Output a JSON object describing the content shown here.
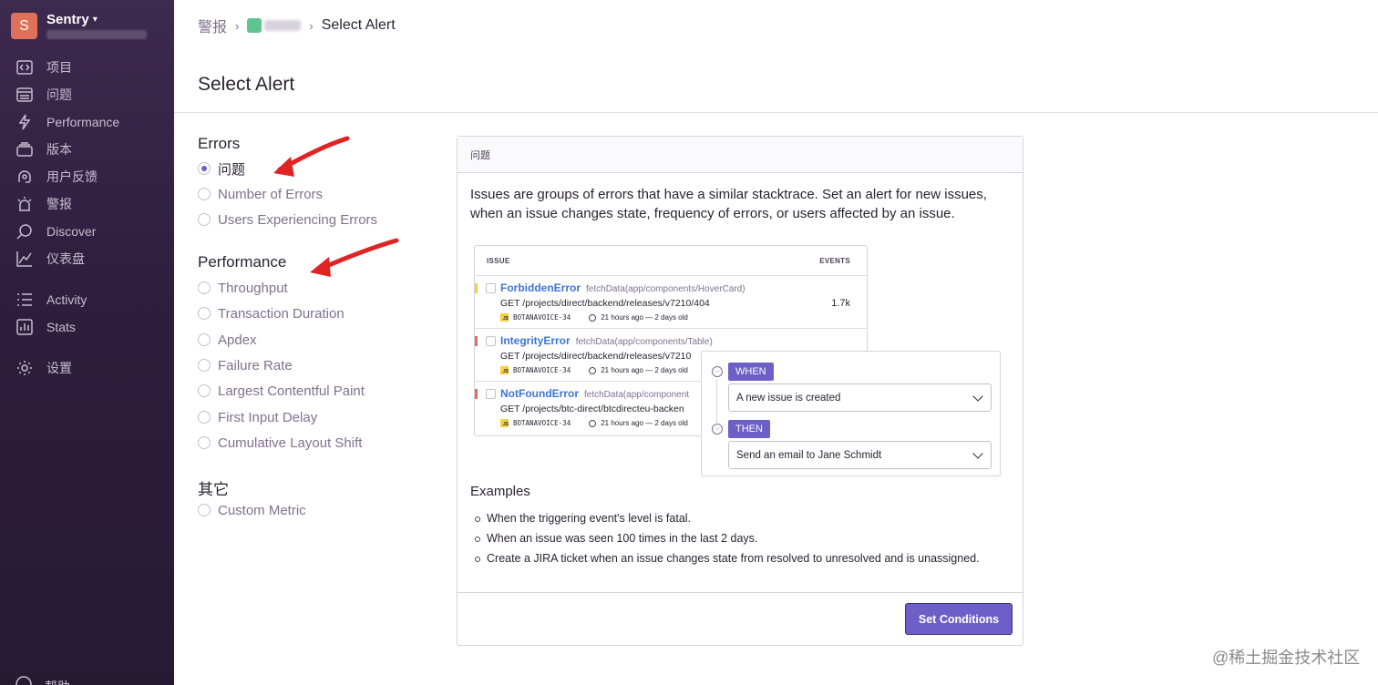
{
  "app": {
    "org_name": "Sentry",
    "org_initial": "S"
  },
  "sidebar": {
    "items": [
      {
        "label": "项目",
        "icon": "projects-icon"
      },
      {
        "label": "问题",
        "icon": "issues-icon"
      },
      {
        "label": "Performance",
        "icon": "performance-icon"
      },
      {
        "label": "版本",
        "icon": "releases-icon"
      },
      {
        "label": "用户反馈",
        "icon": "user-feedback-icon"
      },
      {
        "label": "警报",
        "icon": "alerts-icon"
      },
      {
        "label": "Discover",
        "icon": "discover-icon"
      },
      {
        "label": "仪表盘",
        "icon": "dashboards-icon"
      }
    ],
    "secondary": [
      {
        "label": "Activity",
        "icon": "activity-icon"
      },
      {
        "label": "Stats",
        "icon": "stats-icon"
      }
    ],
    "settings_label": "设置",
    "help_label": "帮助"
  },
  "breadcrumb": {
    "root": "警报",
    "current": "Select Alert"
  },
  "page": {
    "title": "Select Alert"
  },
  "options": {
    "errors": {
      "title": "Errors",
      "items": [
        "问题",
        "Number of Errors",
        "Users Experiencing Errors"
      ],
      "selected": "问题"
    },
    "performance": {
      "title": "Performance",
      "items": [
        "Throughput",
        "Transaction Duration",
        "Apdex",
        "Failure Rate",
        "Largest Contentful Paint",
        "First Input Delay",
        "Cumulative Layout Shift"
      ]
    },
    "other": {
      "title": "其它",
      "items": [
        "Custom Metric"
      ]
    }
  },
  "panel": {
    "header": "问题",
    "description": "Issues are groups of errors that have a similar stacktrace. Set an alert for new issues, when an issue changes state, frequency of errors, or users affected by an issue.",
    "illustration": {
      "col_issue": "ISSUE",
      "col_events": "EVENTS",
      "rows": [
        {
          "title": "ForbiddenError",
          "culprit": "fetchData(app/components/HoverCard)",
          "message": "GET /projects/direct/backend/releases/v7210/404",
          "project": "BOTANAVOICE-34",
          "time": "21 hours ago — 2 days old",
          "events": "1.7k",
          "level_color": "#f5d23c"
        },
        {
          "title": "IntegrityError",
          "culprit": "fetchData(app/components/Table)",
          "message": "GET /projects/direct/backend/releases/v7210",
          "project": "BOTANAVOICE-34",
          "time": "21 hours ago — 2 days old",
          "events": "",
          "level_color": "#e0705a"
        },
        {
          "title": "NotFoundError",
          "culprit": "fetchData(app/component",
          "message": "GET /projects/btc-direct/btcdirecteu-backen",
          "project": "BOTANAVOICE-34",
          "time": "21 hours ago — 2 days old",
          "events": "",
          "level_color": "#e0705a"
        }
      ],
      "when_tag": "WHEN",
      "when_value": "A new issue is created",
      "then_tag": "THEN",
      "then_value": "Send an email to Jane Schmidt"
    },
    "examples_title": "Examples",
    "examples": [
      "When the triggering event's level is fatal.",
      "When an issue was seen 100 times in the last 2 days.",
      "Create a JIRA ticket when an issue changes state from resolved to unresolved and is unassigned."
    ],
    "primary_button": "Set Conditions"
  },
  "watermark": "@稀土掘金技术社区",
  "colors": {
    "accent": "#6c5fc7",
    "sidebar_bg": "#2f1f3f",
    "annotation_arrow": "#e02424"
  }
}
